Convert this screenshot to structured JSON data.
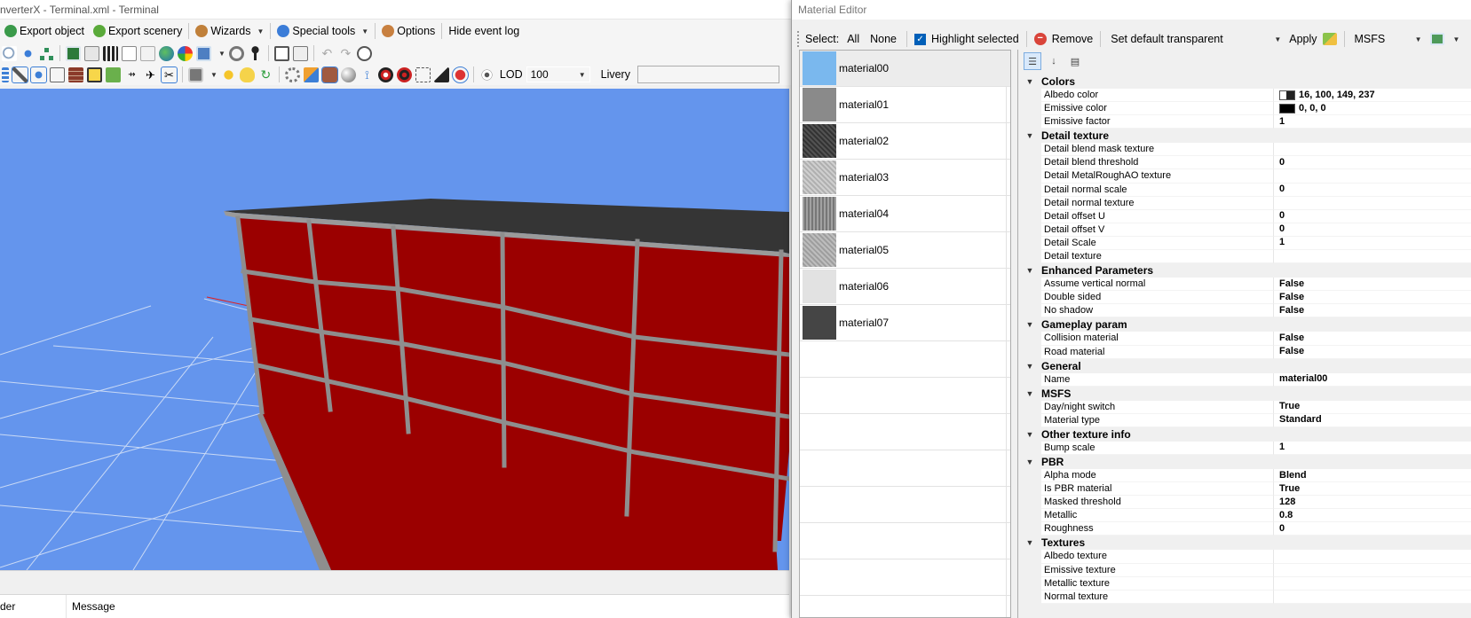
{
  "main_window": {
    "title": "nverterX - Terminal.xml - Terminal",
    "menu": [
      {
        "label": "Export object",
        "icon": "export-object-icon",
        "dropdown": false
      },
      {
        "label": "Export scenery",
        "icon": "export-scenery-icon",
        "dropdown": false
      },
      {
        "label": "Wizards",
        "icon": "wand-icon",
        "dropdown": true
      },
      {
        "label": "Special tools",
        "icon": "gear-icon",
        "dropdown": true
      },
      {
        "label": "Options",
        "icon": "wrench-icon",
        "dropdown": false
      },
      {
        "label": "Hide event log",
        "icon": "",
        "dropdown": false
      }
    ],
    "lod_label": "LOD",
    "lod_value": "100",
    "livery_label": "Livery",
    "livery_value": "",
    "event_log": {
      "col1": "der",
      "col2": "Message"
    }
  },
  "material_editor": {
    "title": "Material Editor",
    "toolbar": {
      "select_label": "Select:",
      "all": "All",
      "none": "None",
      "highlight_selected": "Highlight selected",
      "highlight_checked": true,
      "remove": "Remove",
      "transparency_option": "Set default transparent",
      "apply": "Apply",
      "platform": "MSFS"
    },
    "materials": [
      {
        "name": "material00",
        "swatch": "#7ab8ee",
        "selected": true
      },
      {
        "name": "material01",
        "swatch": "#8a8a8a",
        "selected": false
      },
      {
        "name": "material02",
        "swatch": "#3a3a3a",
        "selected": false
      },
      {
        "name": "material03",
        "swatch": "#c8c8c8",
        "selected": false
      },
      {
        "name": "material04",
        "swatch": "#8c8c8c",
        "selected": false
      },
      {
        "name": "material05",
        "swatch": "#b4b4b4",
        "selected": false
      },
      {
        "name": "material06",
        "swatch": "#e2e2e2",
        "selected": false
      },
      {
        "name": "material07",
        "swatch": "#454545",
        "selected": false
      }
    ],
    "properties": [
      {
        "category": "Colors",
        "rows": [
          {
            "name": "Albedo color",
            "value": "16, 100, 149, 237",
            "swatch": "#6495ed"
          },
          {
            "name": "Emissive color",
            "value": "0, 0, 0",
            "swatch": "#000000"
          },
          {
            "name": "Emissive factor",
            "value": "1"
          }
        ]
      },
      {
        "category": "Detail texture",
        "rows": [
          {
            "name": "Detail blend mask texture",
            "value": ""
          },
          {
            "name": "Detail blend threshold",
            "value": "0"
          },
          {
            "name": "Detail MetalRoughAO texture",
            "value": ""
          },
          {
            "name": "Detail normal scale",
            "value": "0"
          },
          {
            "name": "Detail normal texture",
            "value": ""
          },
          {
            "name": "Detail offset U",
            "value": "0"
          },
          {
            "name": "Detail offset V",
            "value": "0"
          },
          {
            "name": "Detail Scale",
            "value": "1"
          },
          {
            "name": "Detail texture",
            "value": ""
          }
        ]
      },
      {
        "category": "Enhanced Parameters",
        "rows": [
          {
            "name": "Assume vertical normal",
            "value": "False"
          },
          {
            "name": "Double sided",
            "value": "False"
          },
          {
            "name": "No shadow",
            "value": "False"
          }
        ]
      },
      {
        "category": "Gameplay param",
        "rows": [
          {
            "name": "Collision material",
            "value": "False"
          },
          {
            "name": "Road material",
            "value": "False"
          }
        ]
      },
      {
        "category": "General",
        "rows": [
          {
            "name": "Name",
            "value": "material00"
          }
        ]
      },
      {
        "category": "MSFS",
        "rows": [
          {
            "name": "Day/night switch",
            "value": "True"
          },
          {
            "name": "Material type",
            "value": "Standard"
          }
        ]
      },
      {
        "category": "Other texture info",
        "rows": [
          {
            "name": "Bump scale",
            "value": "1"
          }
        ]
      },
      {
        "category": "PBR",
        "rows": [
          {
            "name": "Alpha mode",
            "value": "Blend"
          },
          {
            "name": "Is PBR material",
            "value": "True"
          },
          {
            "name": "Masked threshold",
            "value": "128"
          },
          {
            "name": "Metallic",
            "value": "0.8"
          },
          {
            "name": "Roughness",
            "value": "0"
          }
        ]
      },
      {
        "category": "Textures",
        "rows": [
          {
            "name": "Albedo texture",
            "value": ""
          },
          {
            "name": "Emissive texture",
            "value": ""
          },
          {
            "name": "Metallic texture",
            "value": ""
          },
          {
            "name": "Normal texture",
            "value": ""
          }
        ]
      }
    ]
  },
  "colors": {
    "viewport_bg": "#6495ed",
    "wall_red": "#9b0000",
    "frame_grey": "#8e8e8e",
    "roof": "#333333",
    "accent": "#005fb8"
  }
}
